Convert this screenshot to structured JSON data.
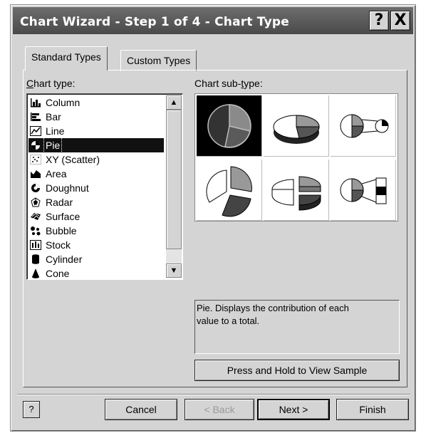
{
  "window": {
    "title": "Chart Wizard - Step 1 of 4 - Chart Type",
    "help_glyph": "?",
    "close_glyph": "X"
  },
  "tabs": [
    {
      "label": "Standard Types",
      "active": true
    },
    {
      "label": "Custom Types",
      "active": false
    }
  ],
  "chart_type": {
    "label": "Chart type:",
    "selected": "Pie",
    "items": [
      {
        "label": "Column",
        "icon": "column-chart-icon"
      },
      {
        "label": "Bar",
        "icon": "bar-chart-icon"
      },
      {
        "label": "Line",
        "icon": "line-chart-icon"
      },
      {
        "label": "Pie",
        "icon": "pie-chart-icon"
      },
      {
        "label": "XY (Scatter)",
        "icon": "scatter-chart-icon"
      },
      {
        "label": "Area",
        "icon": "area-chart-icon"
      },
      {
        "label": "Doughnut",
        "icon": "doughnut-chart-icon"
      },
      {
        "label": "Radar",
        "icon": "radar-chart-icon"
      },
      {
        "label": "Surface",
        "icon": "surface-chart-icon"
      },
      {
        "label": "Bubble",
        "icon": "bubble-chart-icon"
      },
      {
        "label": "Stock",
        "icon": "stock-chart-icon"
      },
      {
        "label": "Cylinder",
        "icon": "cylinder-chart-icon"
      },
      {
        "label": "Cone",
        "icon": "cone-chart-icon"
      }
    ],
    "scroll_up_glyph": "▲",
    "scroll_down_glyph": "▼"
  },
  "subtype": {
    "label": "Chart sub-type:",
    "options": [
      {
        "icon": "pie-icon",
        "selected": true
      },
      {
        "icon": "3d-pie-icon",
        "selected": false
      },
      {
        "icon": "pie-of-pie-icon",
        "selected": false
      },
      {
        "icon": "exploded-pie-icon",
        "selected": false
      },
      {
        "icon": "exploded-3d-pie-icon",
        "selected": false
      },
      {
        "icon": "bar-of-pie-icon",
        "selected": false
      }
    ],
    "description": "Pie. Displays the contribution of each\nvalue to a total."
  },
  "buttons": {
    "sample": "Press and Hold to View Sample",
    "help": "?",
    "cancel": "Cancel",
    "back": "< Back",
    "next": "Next >",
    "finish": "Finish"
  },
  "colors": {
    "face": "#d4d4d4",
    "titlebar": "#555555",
    "selection": "#111111"
  }
}
